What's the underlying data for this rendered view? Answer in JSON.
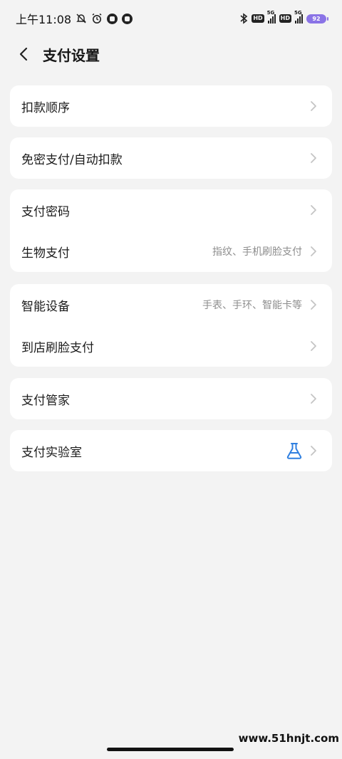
{
  "status_bar": {
    "time": "上午11:08",
    "battery": "92"
  },
  "header": {
    "title": "支付设置"
  },
  "groups": [
    {
      "rows": [
        {
          "label": "扣款顺序",
          "detail": ""
        }
      ]
    },
    {
      "rows": [
        {
          "label": "免密支付/自动扣款",
          "detail": ""
        }
      ]
    },
    {
      "rows": [
        {
          "label": "支付密码",
          "detail": ""
        },
        {
          "label": "生物支付",
          "detail": "指纹、手机刷脸支付"
        }
      ]
    },
    {
      "rows": [
        {
          "label": "智能设备",
          "detail": "手表、手环、智能卡等"
        },
        {
          "label": "到店刷脸支付",
          "detail": ""
        }
      ]
    },
    {
      "rows": [
        {
          "label": "支付管家",
          "detail": ""
        }
      ]
    },
    {
      "rows": [
        {
          "label": "支付实验室",
          "detail": "",
          "icon": "flask-icon"
        }
      ]
    }
  ],
  "watermark": "www.51hnjt.com",
  "colors": {
    "background": "#f3f3f3",
    "card": "#ffffff",
    "chevron": "#c4c4c4",
    "detail_text": "#8d8d8d",
    "flask": "#2f7fe0",
    "battery": "#8a73e6"
  }
}
